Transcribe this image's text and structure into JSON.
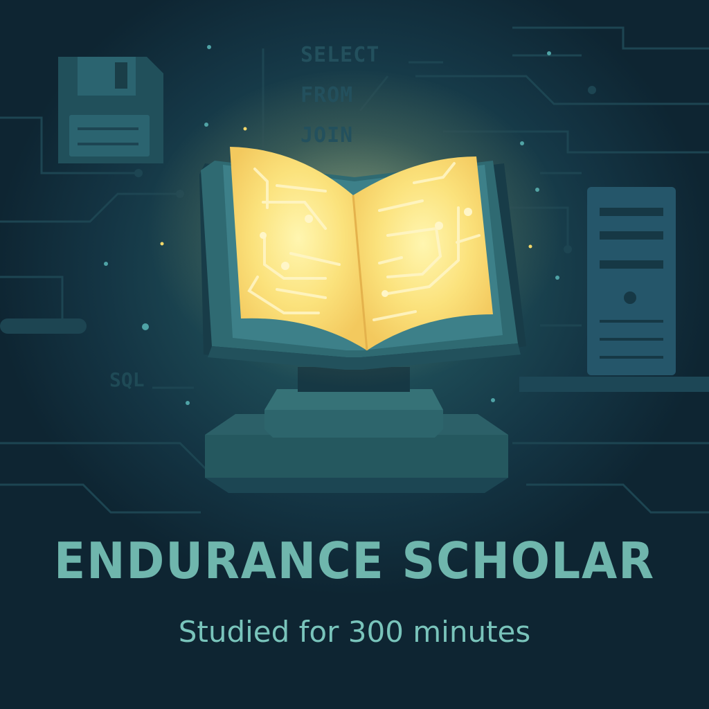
{
  "background_code": {
    "keywords": [
      "SELECT",
      "FROM",
      "JOIN"
    ],
    "side_label": "SQL"
  },
  "achievement": {
    "title": "ENDURANCE SCHOLAR",
    "subtitle": "Studied for 300 minutes"
  },
  "icons": {
    "book": "open-book-icon",
    "pedestal": "pedestal-icon",
    "floppy_disk": "floppy-disk-icon",
    "server": "server-tower-icon"
  },
  "colors": {
    "background": "#143544",
    "title": "#6fb6ad",
    "subtitle": "#79c4bb",
    "page_glow": "#ffe98a"
  }
}
